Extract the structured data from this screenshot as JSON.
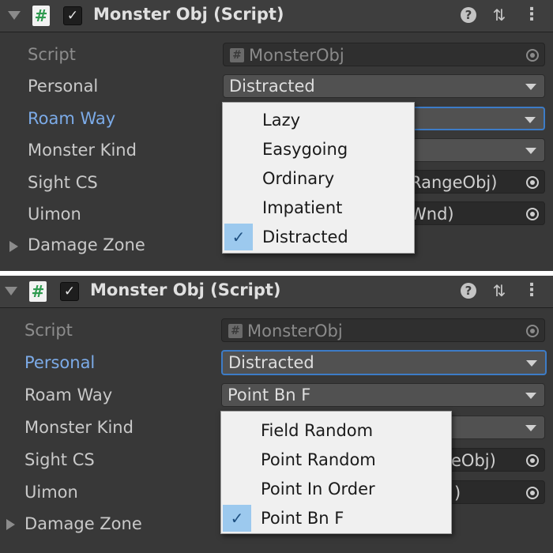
{
  "panels": [
    {
      "title": "Monster Obj (Script)",
      "rows": {
        "script_label": "Script",
        "script_value": "MonsterObj",
        "personal_label": "Personal",
        "personal_value": "Distracted",
        "roam_label": "Roam Way",
        "kind_label": "Monster Kind",
        "sight_label": "Sight CS",
        "sight_value_partial": "RangeObj)",
        "uimon_label": "Uimon",
        "uimon_value_partial": "Wnd)",
        "damage_label": "Damage Zone"
      },
      "dropdown": {
        "options": [
          "Lazy",
          "Easygoing",
          "Ordinary",
          "Impatient",
          "Distracted"
        ],
        "selected": "Distracted"
      }
    },
    {
      "title": "Monster Obj (Script)",
      "rows": {
        "script_label": "Script",
        "script_value": "MonsterObj",
        "personal_label": "Personal",
        "personal_value": "Distracted",
        "roam_label": "Roam Way",
        "roam_value": "Point Bn F",
        "kind_label": "Monster Kind",
        "sight_label": "Sight CS",
        "sight_value_partial": "eObj)",
        "uimon_label": "Uimon",
        "uimon_value_partial": ")",
        "damage_label": "Damage Zone"
      },
      "dropdown": {
        "options": [
          "Field Random",
          "Point Random",
          "Point In Order",
          "Point Bn F"
        ],
        "selected": "Point Bn F"
      }
    }
  ],
  "icons": {
    "script": "hash-script-icon",
    "enabled": "checkmark-icon",
    "help": "question-mark-icon",
    "presets": "sliders-icon",
    "menu": "kebab-menu-icon",
    "object_picker": "target-icon",
    "selected_option": "checkmark-icon"
  },
  "colors": {
    "panel_bg": "#383838",
    "label_active": "#7cabe8",
    "focus_border": "#3d7cc7",
    "popup_bg": "#f0f0f0",
    "selection_bg": "#9cc9ee"
  }
}
